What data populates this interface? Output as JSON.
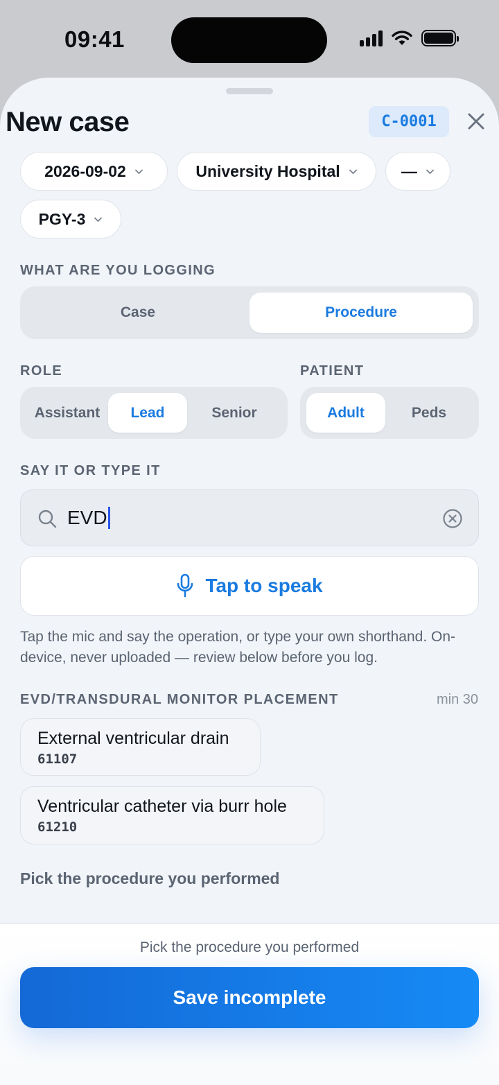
{
  "status_bar": {
    "time": "09:41"
  },
  "sheet": {
    "title": "New case",
    "case_id": "C-0001"
  },
  "filters": {
    "date": "2026-09-02",
    "hospital": "University Hospital",
    "extra": "—",
    "level": "PGY-3"
  },
  "logging": {
    "label": "WHAT ARE YOU LOGGING",
    "options": [
      "Case",
      "Procedure"
    ],
    "selected": "Procedure"
  },
  "role": {
    "label": "ROLE",
    "options": [
      "Assistant",
      "Lead",
      "Senior"
    ],
    "selected": "Lead"
  },
  "patient": {
    "label": "PATIENT",
    "options": [
      "Adult",
      "Peds"
    ],
    "selected": "Adult"
  },
  "input": {
    "label": "SAY IT OR TYPE IT",
    "value": "EVD",
    "speak_label": "Tap to speak",
    "hint": "Tap the mic and say the operation, or type your own shorthand. On-device, never uploaded — review below before you log."
  },
  "results": {
    "group_label": "EVD/TRANSDURAL MONITOR PLACEMENT",
    "min_label": "min 30",
    "items": [
      {
        "name": "External ventricular drain",
        "code": "61107"
      },
      {
        "name": "Ventricular catheter via burr hole",
        "code": "61210"
      }
    ],
    "pick_label": "Pick the procedure you performed"
  },
  "footer": {
    "hint": "Pick the procedure you performed",
    "save_label": "Save incomplete"
  },
  "colors": {
    "accent": "#1a7be0",
    "sheet_bg": "#f1f4f8",
    "segment_bg": "#e4e8ed",
    "muted_text": "#5b6472"
  },
  "icons": [
    "signal-icon",
    "wifi-icon",
    "battery-icon",
    "close-icon",
    "chevron-down-icon",
    "search-icon",
    "clear-icon",
    "mic-icon"
  ]
}
